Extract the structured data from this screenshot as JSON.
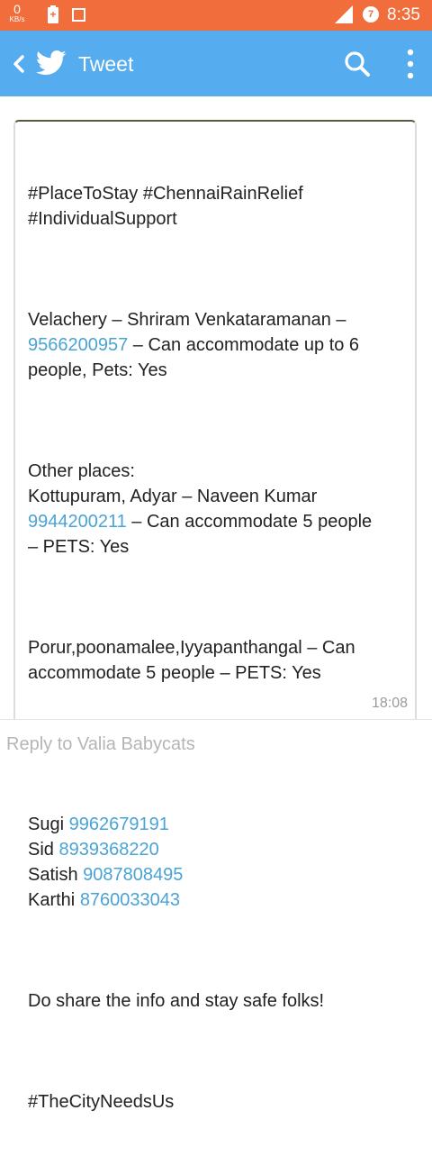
{
  "status_bar": {
    "net_speed_value": "0",
    "net_speed_unit": "KB/s",
    "alarm_badge": "7",
    "time": "8:35"
  },
  "app_bar": {
    "title": "Tweet",
    "color": "#55acee",
    "icons": [
      "chevron-left-icon",
      "twitter-bird-icon",
      "search-icon",
      "more-vert-icon"
    ]
  },
  "tweet": {
    "lines_p1": [
      "#PlaceToStay #ChennaiRainRelief",
      "#IndividualSupport"
    ],
    "p2_a": "Velachery – Shriram Venkataramanan –",
    "p2_phone": "9566200957",
    "p2_b": " – Can accommodate up to 6",
    "p2_c": "people, Pets: Yes",
    "p3_a": "Other places:",
    "p3_b": "Kottupuram, Adyar – Naveen Kumar",
    "p3_phone": "9944200211",
    "p3_c": " – Can accommodate 5 people",
    "p3_d": "– PETS: Yes",
    "p4_a": "Porur,poonamalee,Iyyapanthangal – Can",
    "p4_b": "accommodate 5 people – PETS: Yes",
    "contacts": [
      {
        "name": "Sugi ",
        "phone": "9962679191"
      },
      {
        "name": "Sid ",
        "phone": "8939368220"
      },
      {
        "name": "Satish ",
        "phone": "9087808495"
      },
      {
        "name": "Karthi ",
        "phone": "8760033043"
      }
    ],
    "p6": "Do share the info and stay safe folks!",
    "p7": "#TheCityNeedsUs",
    "time": "18:08",
    "link_color": "#4aa3d6"
  },
  "reply": {
    "placeholder": "Reply to Valia Babycats"
  }
}
